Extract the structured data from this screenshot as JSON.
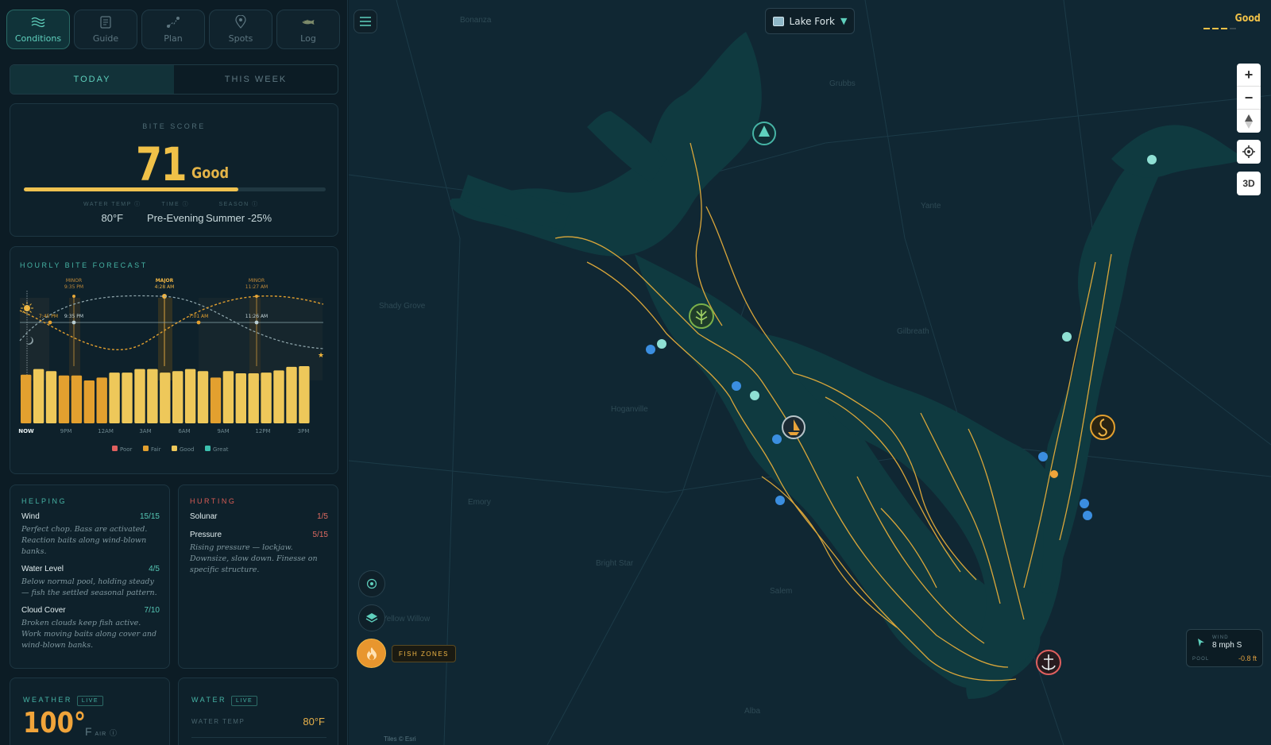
{
  "nav": {
    "tabs": [
      {
        "label": "Conditions",
        "active": true,
        "icon": "waves-icon"
      },
      {
        "label": "Guide",
        "icon": "book-icon"
      },
      {
        "label": "Plan",
        "icon": "route-icon"
      },
      {
        "label": "Spots",
        "icon": "pin-icon"
      },
      {
        "label": "Log",
        "icon": "bass-fish-icon"
      }
    ]
  },
  "segment": {
    "today": "TODAY",
    "week": "THIS WEEK"
  },
  "bite": {
    "caption": "BITE SCORE",
    "score": "71",
    "score_word": "Good",
    "progress": 0.71,
    "meta": [
      {
        "label": "WATER TEMP ⓘ",
        "value": "80°F"
      },
      {
        "label": "TIME ⓘ",
        "value": "Pre-Evening"
      },
      {
        "label": "SEASON ⓘ",
        "value": "Summer -25%"
      }
    ]
  },
  "hourly": {
    "caption": "HOURLY BITE FORECAST",
    "periods": [
      {
        "kind": "MINOR",
        "time": "9:35 PM"
      },
      {
        "kind": "MAJOR",
        "time": "4:28 AM"
      },
      {
        "kind": "MINOR",
        "time": "11:27 AM"
      }
    ],
    "curve_labels": [
      "7:45 PM",
      "9:35 PM",
      "7:01 AM",
      "11:26 AM"
    ],
    "x_labels": [
      "NOW",
      "9PM",
      "12AM",
      "3AM",
      "6AM",
      "9AM",
      "12PM",
      "3PM"
    ],
    "legend": [
      "Poor",
      "Fair",
      "Good",
      "Great"
    ],
    "legend_colors": {
      "Poor": "#e0605f",
      "Fair": "#e3a02f",
      "Good": "#eec85a",
      "Great": "#3cc0ae"
    }
  },
  "chart_data": {
    "type": "bar",
    "title": "HOURLY BITE FORECAST",
    "categories": [
      "NOW",
      "",
      "",
      "9PM",
      "",
      "",
      "12AM",
      "",
      "",
      "3AM",
      "",
      "",
      "6AM",
      "",
      "",
      "9AM",
      "",
      "",
      "12PM",
      "",
      "",
      "3PM",
      "",
      ""
    ],
    "values": [
      68,
      76,
      73,
      67,
      67,
      60,
      64,
      71,
      71,
      76,
      76,
      71,
      73,
      76,
      73,
      64,
      73,
      70,
      70,
      71,
      74,
      79,
      80,
      0
    ],
    "ylim": [
      0,
      100
    ]
  },
  "helping": {
    "caption": "HELPING",
    "items": [
      {
        "name": "Wind",
        "score": "15/15",
        "desc": "Perfect chop. Bass are activated. Reaction baits along wind-blown banks."
      },
      {
        "name": "Water Level",
        "score": "4/5",
        "desc": "Below normal pool, holding steady — fish the settled seasonal pattern."
      },
      {
        "name": "Cloud Cover",
        "score": "7/10",
        "desc": "Broken clouds keep fish active. Work moving baits along cover and wind-blown banks."
      }
    ]
  },
  "hurting": {
    "caption": "HURTING",
    "items": [
      {
        "name": "Solunar",
        "score": "1/5",
        "desc": ""
      },
      {
        "name": "Pressure",
        "score": "5/15",
        "desc": "Rising pressure — lockjaw. Downsize, slow down. Finesse on specific structure."
      }
    ]
  },
  "weather": {
    "caption": "WEATHER",
    "badge": "LIVE",
    "temp": "100°",
    "unit": "F",
    "unit_sub": "AIR"
  },
  "water": {
    "caption": "WATER",
    "badge": "LIVE",
    "temp_label": "WATER TEMP",
    "temp_value": "80°F"
  },
  "map": {
    "lake": "Lake Fork",
    "lake_icon": "map-icon",
    "status": "Good",
    "zoom_in": "+",
    "zoom_out": "−",
    "btn_3d": "3D",
    "fish_zones": "FISH ZONES",
    "wind_label": "WIND",
    "wind_value": "8 mph S",
    "pool_label": "POOL",
    "pool_value": "-0.8 ft",
    "attribution": "Tiles © Esri",
    "places": [
      "Bonanza",
      "Grubbs",
      "Yante",
      "Shady Grove",
      "Hoganville",
      "Emory",
      "Bright Star",
      "Salem",
      "Alba",
      "Yellow Willow",
      "Gilbreath"
    ]
  }
}
